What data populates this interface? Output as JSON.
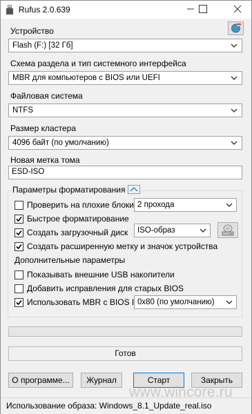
{
  "window": {
    "title": "Rufus 2.0.639"
  },
  "device": {
    "label": "Устройство",
    "value": "Flash (F:) [32 Гб]"
  },
  "partition": {
    "label": "Схема раздела и тип системного интерфейса",
    "value": "MBR для компьютеров с BIOS или UEFI"
  },
  "filesystem": {
    "label": "Файловая система",
    "value": "NTFS"
  },
  "cluster": {
    "label": "Размер кластера",
    "value": "4096 байт (по умолчанию)"
  },
  "volume": {
    "label": "Новая метка тома",
    "value": "ESD-ISO"
  },
  "format_options": {
    "title": "Параметры форматирования",
    "bad_blocks": {
      "label": "Проверить на плохие блоки",
      "checked": false,
      "passes": "2 прохода"
    },
    "quick_format": {
      "label": "Быстрое форматирование",
      "checked": true
    },
    "bootable": {
      "label": "Создать загрузочный диск",
      "checked": true,
      "type": "ISO-образ"
    },
    "extended_label": {
      "label": "Создать расширенную метку и значок устройства",
      "checked": true
    }
  },
  "advanced": {
    "title": "Дополнительные параметры",
    "external_usb": {
      "label": "Показывать внешние USB накопители",
      "checked": false
    },
    "old_bios": {
      "label": "Добавить исправления для старых BIOS",
      "checked": false
    },
    "mbr_bios_id": {
      "label": "Использовать MBR с BIOS ID",
      "checked": true,
      "value": "0x80 (по умолчанию)"
    }
  },
  "progress": {
    "value": 0
  },
  "status": {
    "text": "Готов"
  },
  "buttons": {
    "about": "О программе...",
    "log": "Журнал",
    "start": "Старт",
    "close": "Закрыть"
  },
  "statusbar": {
    "text": "Использование образа: Windows_8.1_Update_real.iso"
  },
  "watermark": {
    "text": "www.wincore.ru"
  },
  "colors": {
    "accent": "#0078d7",
    "progress": "#06b025"
  }
}
